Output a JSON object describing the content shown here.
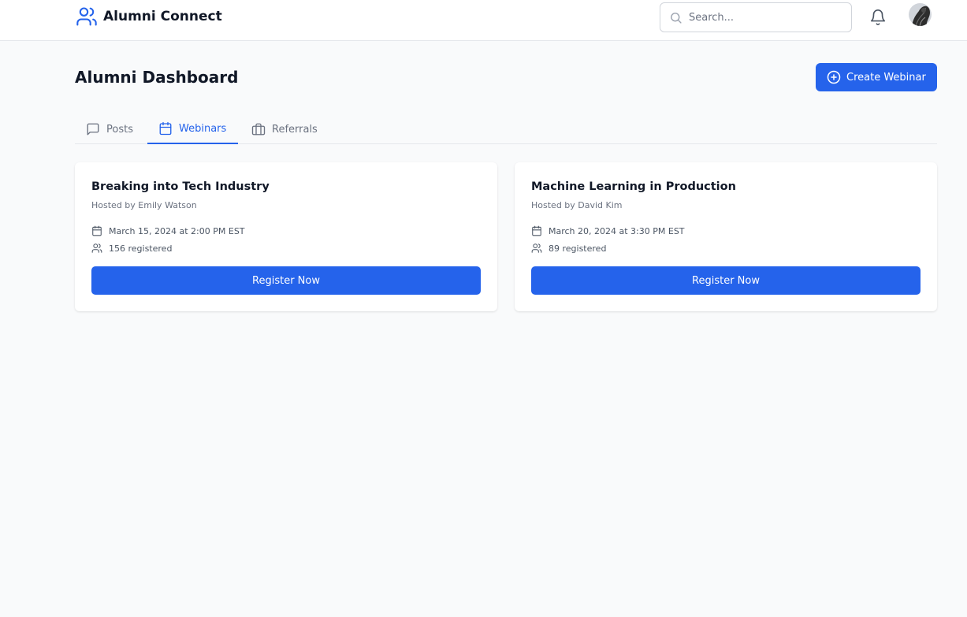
{
  "app": {
    "name": "Alumni Connect"
  },
  "search": {
    "placeholder": "Search..."
  },
  "page": {
    "title": "Alumni Dashboard",
    "create_button": "Create Webinar"
  },
  "tabs": [
    {
      "label": "Posts",
      "icon": "message-square-icon",
      "active": false
    },
    {
      "label": "Webinars",
      "icon": "calendar-icon",
      "active": true
    },
    {
      "label": "Referrals",
      "icon": "briefcase-icon",
      "active": false
    }
  ],
  "webinars": [
    {
      "title": "Breaking into Tech Industry",
      "host": "Hosted by Emily Watson",
      "datetime": "March 15, 2024 at 2:00 PM EST",
      "registered": "156 registered",
      "button": "Register Now"
    },
    {
      "title": "Machine Learning in Production",
      "host": "Hosted by David Kim",
      "datetime": "March 20, 2024 at 3:30 PM EST",
      "registered": "89 registered",
      "button": "Register Now"
    }
  ],
  "colors": {
    "accent": "#2563eb",
    "background": "#f9fafb"
  }
}
